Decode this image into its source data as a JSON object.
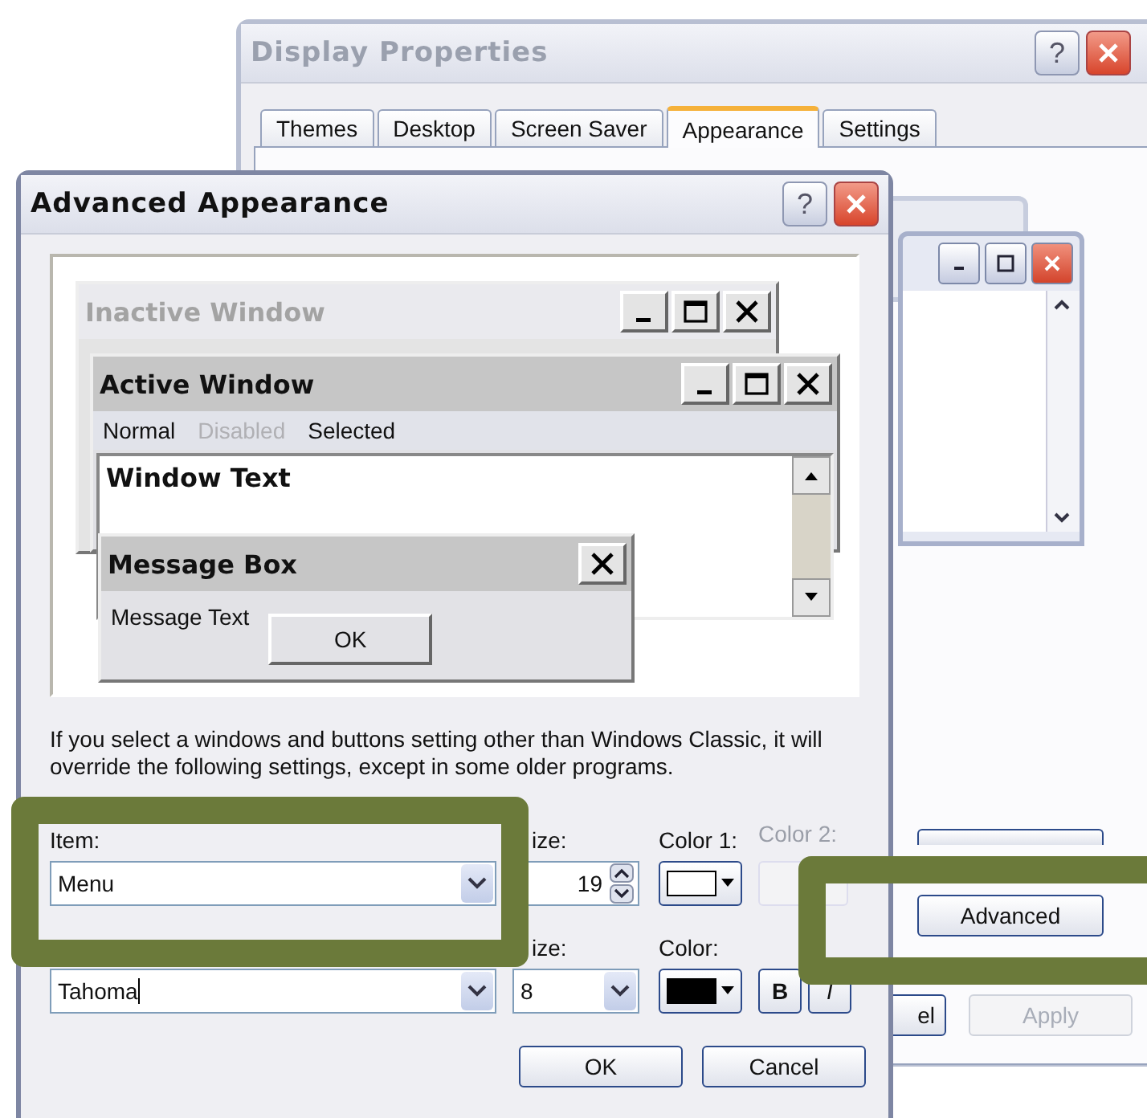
{
  "display_properties": {
    "title": "Display Properties",
    "help": "?",
    "tabs": [
      {
        "label": "Themes",
        "selected": false
      },
      {
        "label": "Desktop",
        "selected": false
      },
      {
        "label": "Screen Saver",
        "selected": false
      },
      {
        "label": "Appearance",
        "selected": true
      },
      {
        "label": "Settings",
        "selected": false
      }
    ],
    "buttons": [
      {
        "label": "Advanced",
        "disabled": false
      },
      {
        "label": "el",
        "disabled": false
      },
      {
        "label": "Apply",
        "disabled": true
      }
    ]
  },
  "advanced_appearance": {
    "title": "Advanced Appearance",
    "help": "?",
    "preview": {
      "inactive_title": "Inactive Window",
      "active_title": "Active Window",
      "menu": [
        {
          "label": "Normal",
          "kind": "normal"
        },
        {
          "label": "Disabled",
          "kind": "disabled"
        },
        {
          "label": "Selected",
          "kind": "selected"
        }
      ],
      "window_text": "Window Text",
      "message_title": "Message Box",
      "message_text": "Message Text",
      "message_button": "OK"
    },
    "note": "If you select a windows and buttons setting other than Windows Classic, it will override the following settings, except in some older programs.",
    "item_label": "Item:",
    "item_value": "Menu",
    "size_label": "ize:",
    "size_value": "19",
    "color1_label": "Color 1:",
    "color1_swatch": {
      "color": "#ffffff"
    },
    "color2_label": "Color 2:",
    "color2_disabled": true,
    "font_value": "Tahoma",
    "font_size_label": "ize:",
    "font_size_value": "8",
    "font_color_label": "Color:",
    "font_color_swatch": {
      "color": "#000000"
    },
    "bold_label": "B",
    "italic_label": "I",
    "buttons": [
      "OK",
      "Cancel"
    ]
  }
}
